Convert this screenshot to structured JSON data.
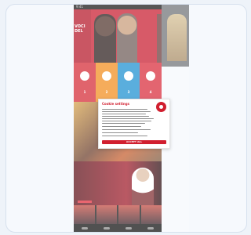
{
  "statusbar": {
    "time": "9:41"
  },
  "hero": {
    "text": "VOCI\nDEL"
  },
  "channels": [
    {
      "number": "1",
      "color": "#d42934"
    },
    {
      "number": "2",
      "color": "#f28d1c"
    },
    {
      "number": "3",
      "color": "#1b8fd0"
    },
    {
      "number": "4",
      "color": "#d92a3a"
    }
  ],
  "dialog": {
    "title": "Cookie settings",
    "button_label": "ACCEPT ALL"
  },
  "theme": {
    "accent": "#d11f2f",
    "page_background": "#eef3f9"
  }
}
